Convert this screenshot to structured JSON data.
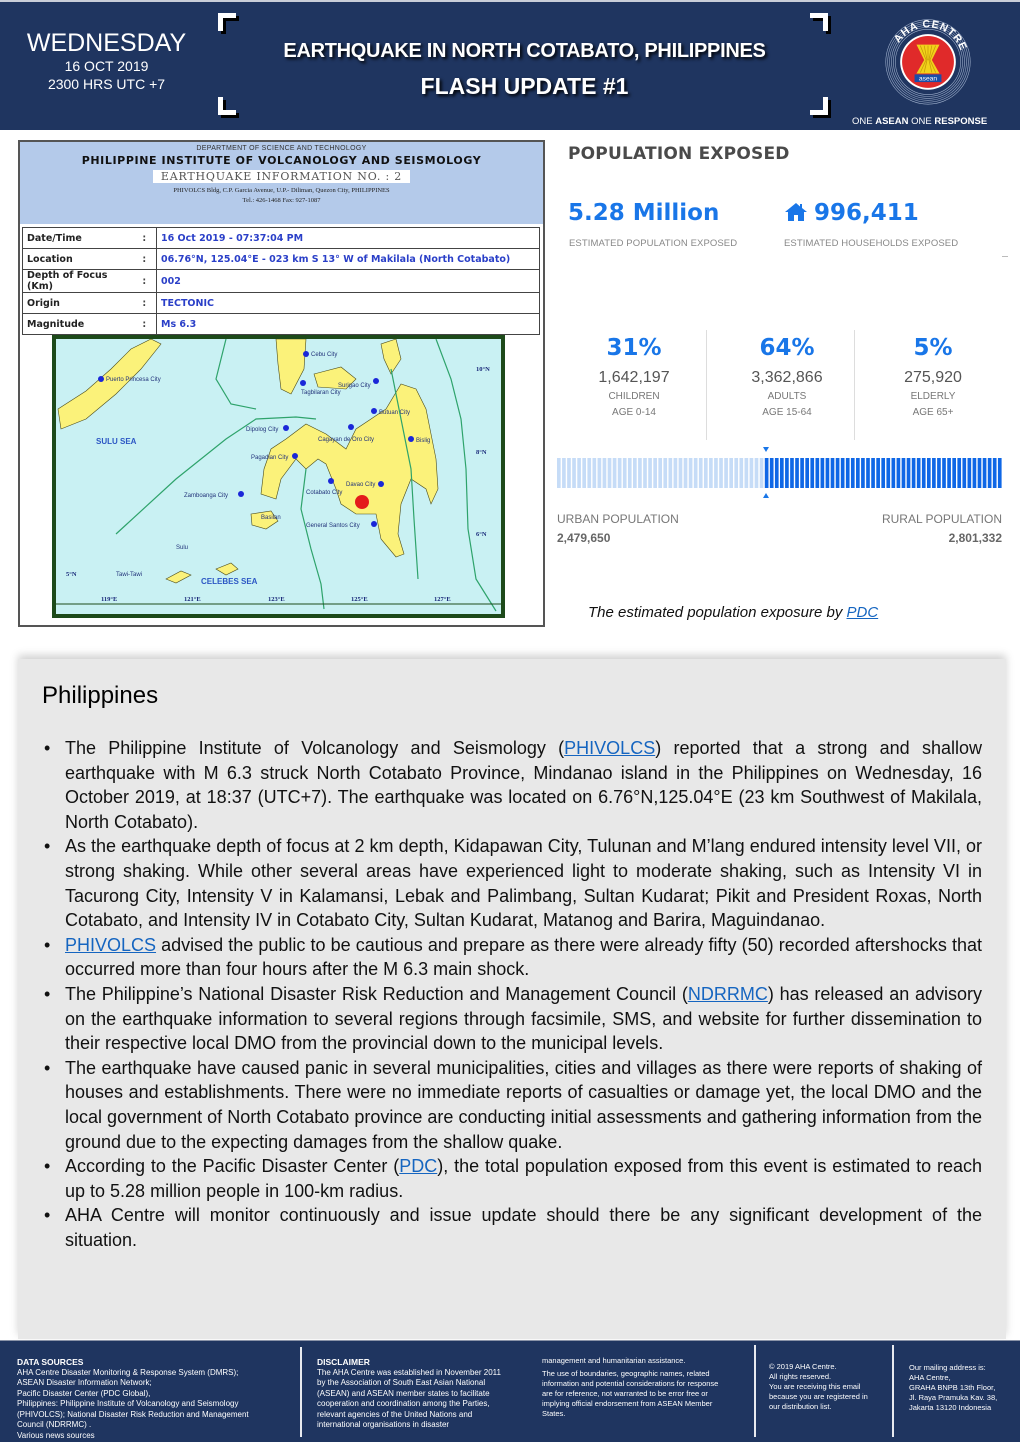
{
  "header": {
    "day": "WEDNESDAY",
    "date": "16 OCT 2019",
    "time": "2300 HRS UTC +7",
    "title": "EARTHQUAKE IN NORTH COTABATO, PHILIPPINES",
    "subtitle": "FLASH UPDATE #1",
    "logo_text": "AHA CENTRE",
    "logo_inner": "asean",
    "tagline_1": "ONE ",
    "tagline_2": "ASEAN",
    "tagline_3": " ONE ",
    "tagline_4": "RESPONSE"
  },
  "phivolcs": {
    "department": "DEPARTMENT OF SCIENCE AND TECHNOLOGY",
    "institute": "PHILIPPINE INSTITUTE OF VOLCANOLOGY AND SEISMOLOGY",
    "bulletin": "EARTHQUAKE INFORMATION NO. : 2",
    "address": "PHIVOLCS Bldg, C.P. Garcia Avenue, U.P.- Diliman, Quezon City, PHILIPPINES",
    "phone": "Tel.: 426-1468  Fax: 927-1087",
    "rows": [
      {
        "key": "Date/Time",
        "sep": ":",
        "value": "16 Oct 2019 - 07:37:04 PM"
      },
      {
        "key": "Location",
        "sep": ":",
        "value": "06.76°N, 125.04°E - 023 km S 13° W of Makilala (North Cotabato)"
      },
      {
        "key": "Depth of Focus (Km)",
        "sep": ":",
        "value": "002"
      },
      {
        "key": "Origin",
        "sep": ":",
        "value": "TECTONIC"
      },
      {
        "key": "Magnitude",
        "sep": ":",
        "value": "Ms 6.3"
      }
    ],
    "map": {
      "seas": [
        "SULU SEA",
        "CELEBES SEA"
      ],
      "cities": [
        "Cebu City",
        "Puerto Princesa City",
        "Surigao City",
        "Tagbilaran City",
        "Butuan City",
        "Dipolog City",
        "Cagayan de Oro City",
        "Bislig",
        "Pagadian City",
        "Davao City",
        "Cotabato City",
        "Zamboanga City",
        "Basilan",
        "General Santos City",
        "Sulu",
        "Tawi-Tawi"
      ],
      "lat_labels": [
        "10°N",
        "8°N",
        "6°N",
        "5°N"
      ],
      "lon_labels": [
        "119°E",
        "121°E",
        "123°E",
        "125°E",
        "127°E"
      ],
      "epicenter": {
        "lat": 6.76,
        "lon": 125.04
      }
    }
  },
  "pdc": {
    "title": "POPULATION EXPOSED",
    "population_value": "5.28 Million",
    "population_label": "ESTIMATED POPULATION EXPOSED",
    "households_value": "996,411",
    "households_label": "ESTIMATED HOUSEHOLDS EXPOSED",
    "age_groups": [
      {
        "pct": "31%",
        "count": "1,642,197",
        "label": "CHILDREN",
        "range": "AGE 0-14"
      },
      {
        "pct": "64%",
        "count": "3,362,866",
        "label": "ADULTS",
        "range": "AGE 15-64"
      },
      {
        "pct": "5%",
        "count": "275,920",
        "label": "ELDERLY",
        "range": "AGE 65+"
      }
    ],
    "urban_label": "URBAN POPULATION",
    "urban_value": "2,479,650",
    "rural_label": "RURAL POPULATION",
    "rural_value": "2,801,332",
    "urban_fraction": 0.4695,
    "caption_text": "The estimated population exposure by ",
    "caption_link": "PDC",
    "colors": {
      "accent": "#1976e8",
      "urban_bar": "#c6dcf7",
      "rural_bar": "#0f67e6"
    }
  },
  "philippines": {
    "title": "Philippines",
    "bullets": [
      {
        "pre": "The Philippine Institute of Volcanology and Seismology (",
        "link": "PHIVOLCS",
        "post": ") reported that a strong and shallow earthquake with M 6.3 struck North Cotabato Province, Mindanao island in the Philippines on Wednesday, 16 October 2019, at 18:37 (UTC+7). The earthquake was located on 6.76°N,125.04°E (23 km Southwest of Makilala, North Cotabato)."
      },
      {
        "pre": "As the earthquake depth of focus at 2 km depth, Kidapawan City, Tulunan and M’lang endured intensity level VII, or strong shaking. While other several areas have experienced light to moderate shaking, such as Intensity VI in Tacurong City, Intensity V in Kalamansi, Lebak and Palimbang, Sultan Kudarat; Pikit and President Roxas, North Cotabato, and Intensity IV in Cotabato City, Sultan Kudarat, Matanog and Barira, Maguindanao.",
        "link": "",
        "post": ""
      },
      {
        "pre": "",
        "link": "PHIVOLCS",
        "post": " advised the public to be cautious and prepare as there were already fifty (50) recorded aftershocks that occurred more than four hours after the M 6.3 main shock."
      },
      {
        "pre": "The Philippine’s National Disaster Risk Reduction and Management Council (",
        "link": "NDRRMC",
        "post": ") has released an advisory on the earthquake information to several regions through facsimile, SMS, and website for further dissemination to their respective local DMO from the provincial down to the municipal levels."
      },
      {
        "pre": "The earthquake have caused panic in several municipalities, cities and villages as there were reports of shaking of houses and establishments. There were no immediate reports of casualties or damage yet, the local DMO and the local government of North Cotabato province are conducting initial assessments and gathering information from the ground due to the expecting damages from the shallow quake.",
        "link": "",
        "post": ""
      },
      {
        "pre": "According to the Pacific Disaster Center (",
        "link": "PDC",
        "post": "), the total population exposed from this event is estimated to reach up to 5.28 million people in 100-km radius."
      },
      {
        "pre": "AHA Centre will monitor continuously and issue update should there be any significant development of the situation.",
        "link": "",
        "post": ""
      }
    ]
  },
  "footer": {
    "sources_title": "DATA SOURCES",
    "sources": [
      "AHA Centre Disaster Monitoring & Response System (DMRS);",
      "ASEAN Disaster Information Network;",
      "Pacific Disaster Center (PDC Global),",
      "Philippines: Philippine Institute of Volcanology and Seismology",
      "(PHIVOLCS); National Disaster Risk Reduction and Management",
      "Council (NDRRMC) .",
      "Various news sources"
    ],
    "disclaimer_title": "DISCLAIMER",
    "disclaimer": [
      "The  AHA Centre was established in November 2011",
      "by the Association of South East Asian National",
      "(ASEAN) and ASEAN member states to facilitate",
      "cooperation and coordination among the Parties,",
      "relevant agencies of the United Nations and",
      "international organisations in disaster"
    ],
    "disclaimer_cont": [
      "management and humanitarian assistance.",
      "The use of boundaries, geographic names, related",
      "information and potential considerations for response",
      "are for reference, not warranted to be error free or",
      "implying official endorsement from ASEAN Member",
      "States."
    ],
    "rights": [
      "© 2019 AHA Centre.",
      "All rights reserved.",
      "You are receiving this email",
      "because you are registered in",
      "our distribution list."
    ],
    "address": [
      "Our mailing address is:",
      "AHA Centre,",
      "GRAHA BNPB 13th Floor,",
      "Jl. Raya Pramuka Kav. 38,",
      "Jakarta 13120 Indonesia"
    ]
  }
}
